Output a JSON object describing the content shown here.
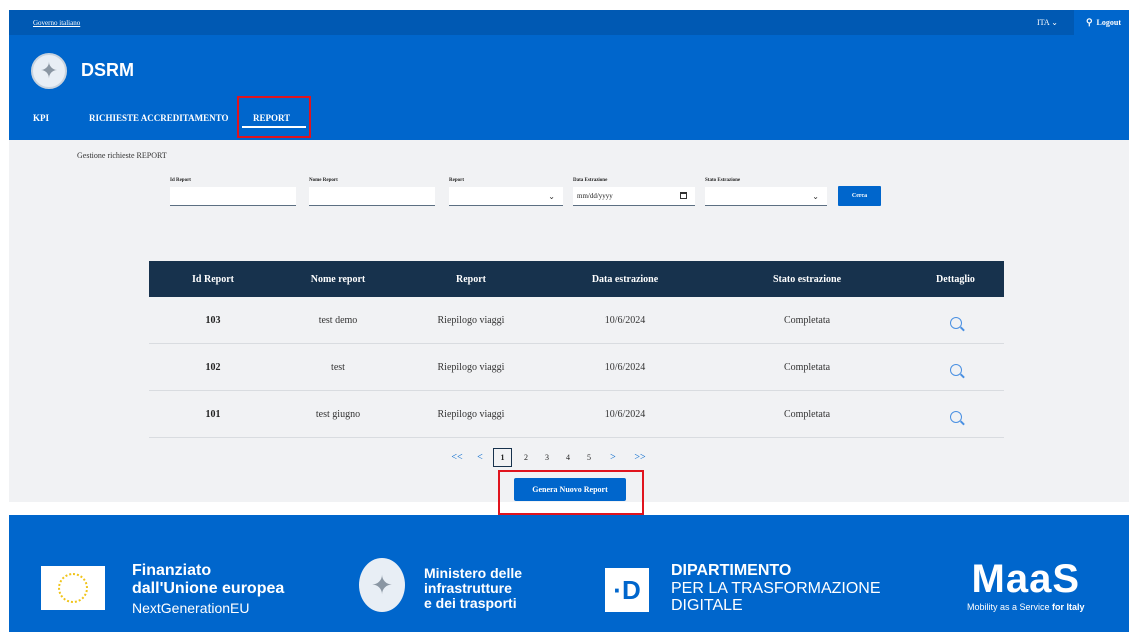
{
  "topbar": {
    "government_link": "Governo italiano",
    "language": "ITA ⌄",
    "logout_label": "Logout"
  },
  "header": {
    "brand": "DSRM",
    "nav": [
      {
        "label": "KPI"
      },
      {
        "label": "RICHIESTE ACCREDITAMENTO"
      },
      {
        "label": "REPORT"
      }
    ]
  },
  "filters": {
    "section_title": "Gestione richieste REPORT",
    "id_report_label": "Id Report",
    "nome_report_label": "Nome Report",
    "report_label": "Report",
    "data_estrazione_label": "Data Estrazione",
    "data_estrazione_placeholder": "mm/dd/yyyy",
    "stato_estrazione_label": "Stato Estrazione",
    "search_button": "Cerca"
  },
  "table": {
    "columns": [
      "Id Report",
      "Nome report",
      "Report",
      "Data estrazione",
      "Stato estrazione",
      "Dettaglio"
    ],
    "rows": [
      {
        "id": "103",
        "nome": "test demo",
        "report": "Riepilogo viaggi",
        "data": "10/6/2024",
        "stato": "Completata"
      },
      {
        "id": "102",
        "nome": "test",
        "report": "Riepilogo viaggi",
        "data": "10/6/2024",
        "stato": "Completata"
      },
      {
        "id": "101",
        "nome": "test giugno",
        "report": "Riepilogo viaggi",
        "data": "10/6/2024",
        "stato": "Completata"
      }
    ]
  },
  "pagination": {
    "first": "<<",
    "prev": "<",
    "pages": [
      "1",
      "2",
      "3",
      "4",
      "5"
    ],
    "next": ">",
    "last": ">>"
  },
  "actions": {
    "generate_button": "Genera Nuovo Report"
  },
  "footer": {
    "eu_line1": "Finanziato",
    "eu_line2": "dall'Unione europea",
    "eu_line3": "NextGenerationEU",
    "mit_line1": "Ministero delle",
    "mit_line2": "infrastrutture",
    "mit_line3": "e dei trasporti",
    "dtd_logo": "·D",
    "dtd_line1": "DIPARTIMENTO",
    "dtd_line2": "PER LA TRASFORMAZIONE",
    "dtd_line3": "DIGITALE",
    "maas_logo": "MaaS",
    "maas_tag": "Mobility as a Service",
    "maas_tag_bold": "for Italy"
  },
  "colors": {
    "primary": "#0066cc",
    "top_bar": "#0059b3",
    "table_header": "#17324d",
    "highlight": "#e0141e"
  }
}
